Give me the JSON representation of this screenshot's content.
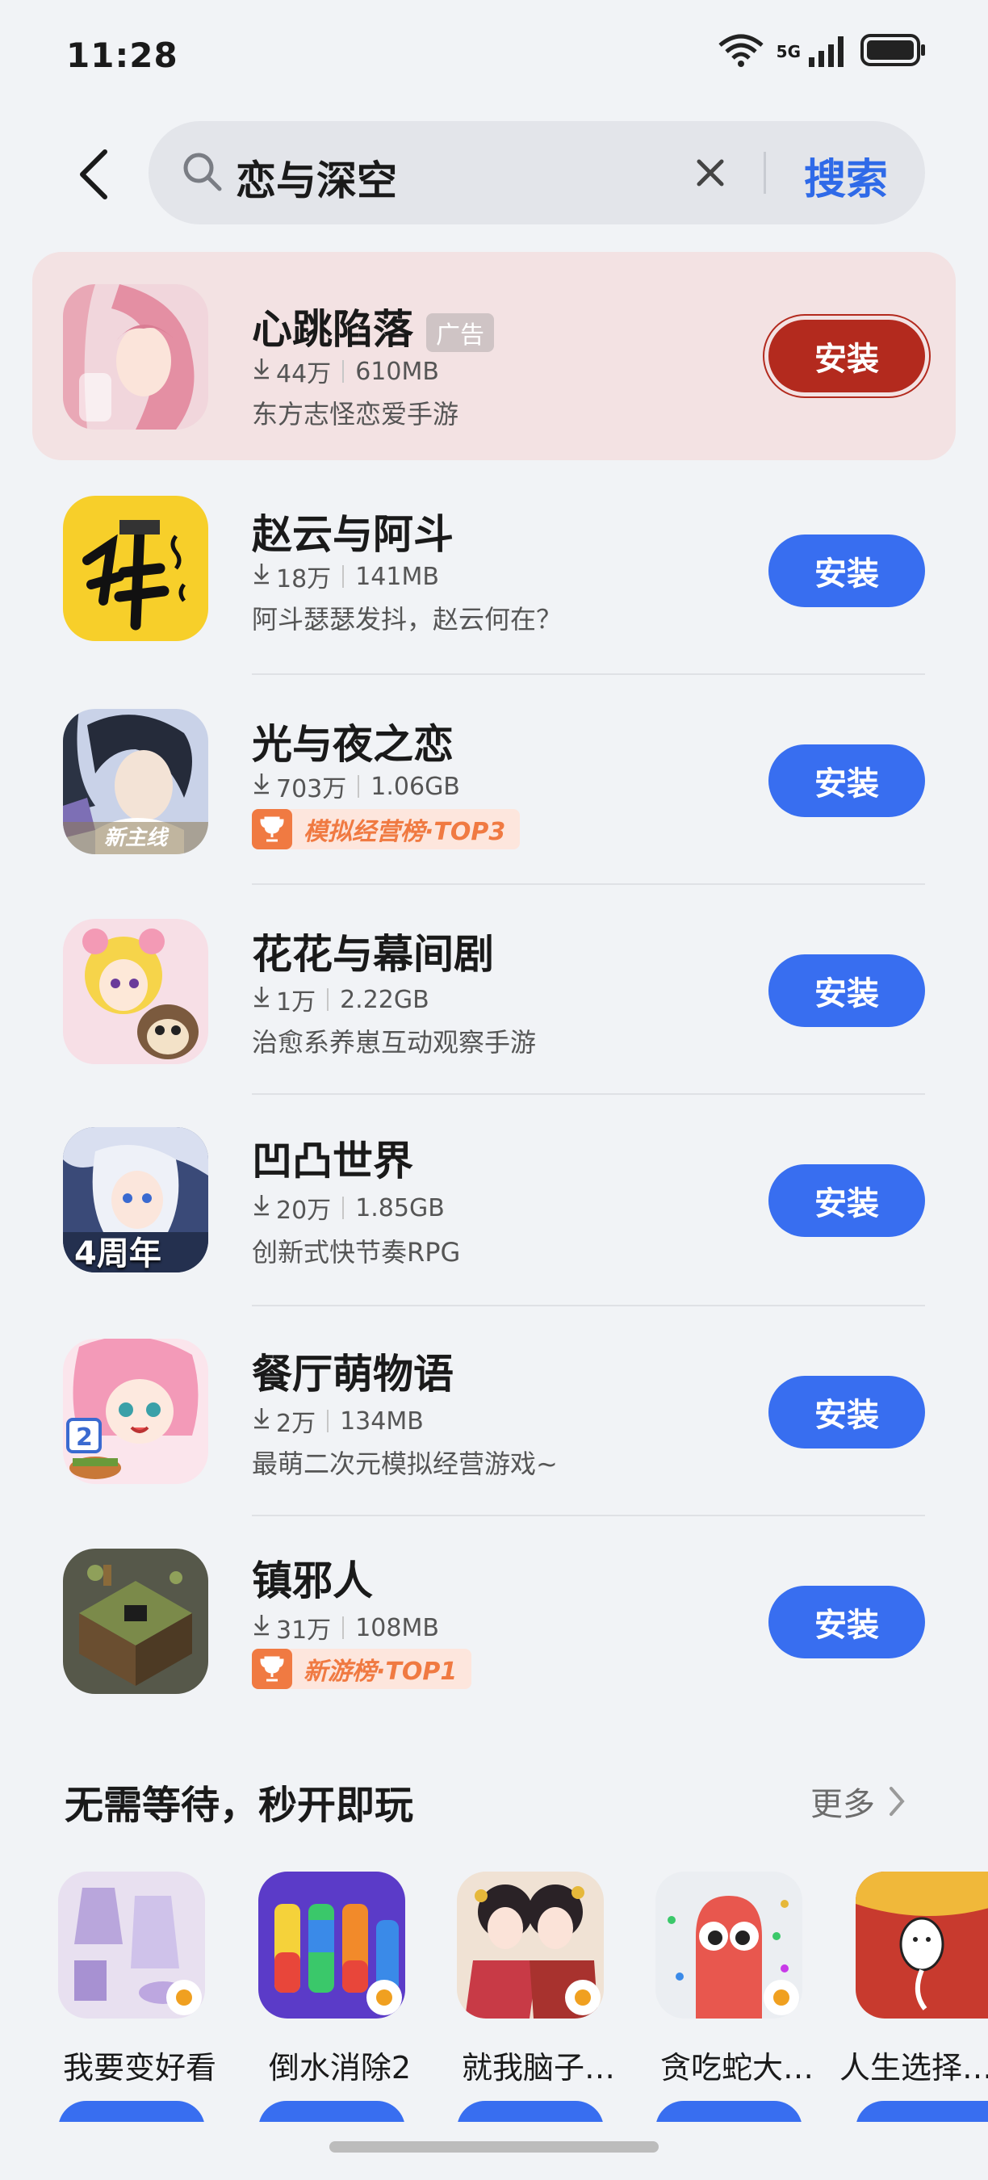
{
  "status_bar": {
    "time": "11:28",
    "network": "5G",
    "wifi_label": "6"
  },
  "search": {
    "query": "恋与深空",
    "submit_label": "搜索"
  },
  "colors": {
    "accent": "#386ef0",
    "ad_button": "#b32a1e",
    "rank_orange": "#f07a42"
  },
  "ad": {
    "name": "心跳陷落",
    "tag": "广告",
    "downloads": "44万",
    "size": "610MB",
    "desc": "东方志怪恋爱手游",
    "button": "安装"
  },
  "apps": [
    {
      "name": "赵云与阿斗",
      "downloads": "18万",
      "size": "141MB",
      "desc": "阿斗瑟瑟发抖，赵云何在？",
      "button": "安装"
    },
    {
      "name": "光与夜之恋",
      "downloads": "703万",
      "size": "1.06GB",
      "rank": "模拟经营榜·TOP3",
      "button": "安装"
    },
    {
      "name": "花花与幕间剧",
      "downloads": "1万",
      "size": "2.22GB",
      "desc": "治愈系养崽互动观察手游",
      "button": "安装"
    },
    {
      "name": "凹凸世界",
      "downloads": "20万",
      "size": "1.85GB",
      "desc": "创新式快节奏RPG",
      "button": "安装",
      "icon_text": "4周年"
    },
    {
      "name": "餐厅萌物语",
      "downloads": "2万",
      "size": "134MB",
      "desc": "最萌二次元模拟经营游戏~",
      "button": "安装"
    },
    {
      "name": "镇邪人",
      "downloads": "31万",
      "size": "108MB",
      "rank": "新游榜·TOP1",
      "button": "安装"
    }
  ],
  "instant_section": {
    "title": "无需等待，秒开即玩",
    "more": "更多",
    "items": [
      {
        "label": "我要变好看"
      },
      {
        "label": "倒水消除2"
      },
      {
        "label": "就我脑子…"
      },
      {
        "label": "贪吃蛇大…"
      },
      {
        "label": "人生选择…"
      }
    ]
  },
  "icon_overlay": {
    "new_line": "新主线"
  }
}
